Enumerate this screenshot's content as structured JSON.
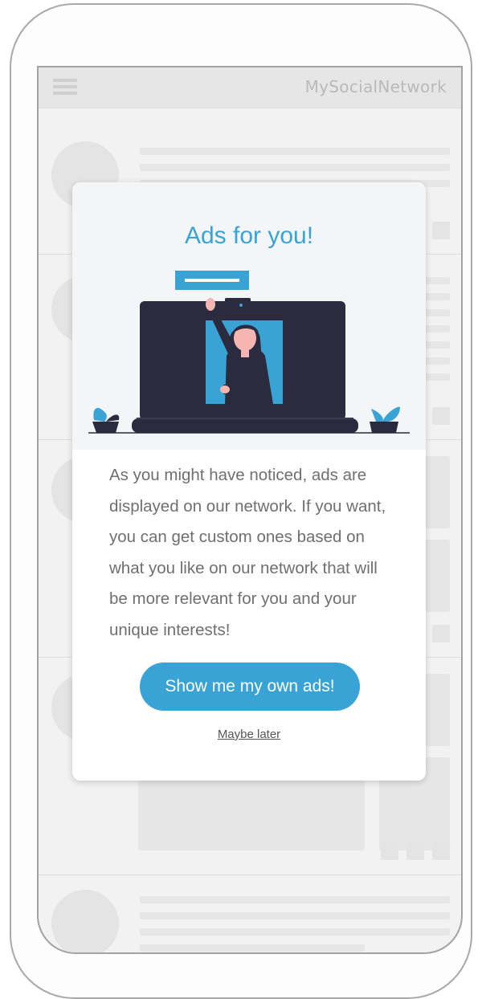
{
  "app": {
    "brand": "MySocialNetwork"
  },
  "modal": {
    "title": "Ads for you!",
    "body": "As you might have noticed, ads are displayed on our network. If you want, you can get custom ones based on what you like on our network that will be more relevant for you and your unique interests!",
    "primary_button": "Show me my own ads!",
    "secondary_link": "Maybe later"
  },
  "colors": {
    "accent": "#3aa3d5",
    "laptop": "#2b2b3f",
    "background": "#f2f2f2"
  },
  "icons": [
    "hamburger-menu-icon"
  ]
}
